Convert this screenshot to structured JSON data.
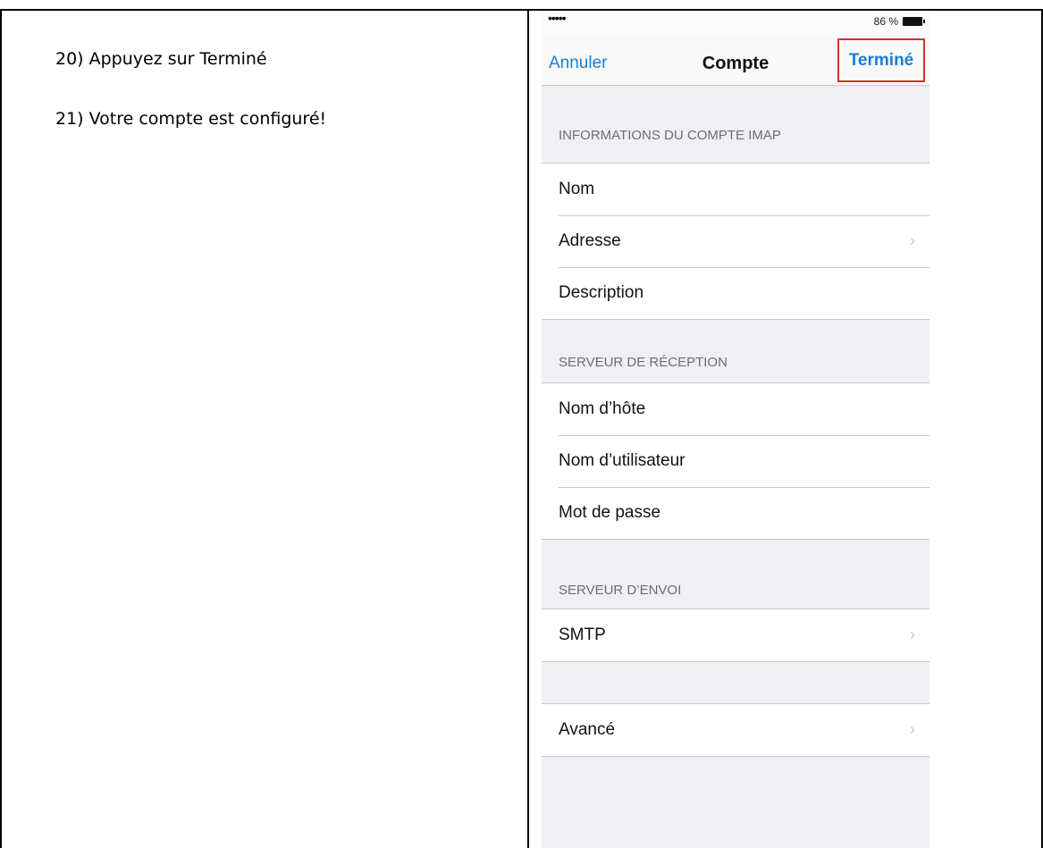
{
  "document": {
    "steps": [
      "20) Appuyez sur Terminé",
      "21) Votre compte est configuré!"
    ]
  },
  "phone": {
    "status_bar": {
      "signal": "•••••",
      "battery_text": "86 %"
    },
    "nav": {
      "cancel": "Annuler",
      "title": "Compte",
      "done": "Terminé"
    },
    "sections": [
      {
        "header": "INFORMATIONS DU COMPTE IMAP",
        "rows": [
          "Nom",
          "Adresse",
          "Description"
        ]
      },
      {
        "header": "SERVEUR DE RÉCEPTION",
        "rows": [
          "Nom d’hôte",
          "Nom d’utilisateur",
          "Mot de passe"
        ]
      },
      {
        "header": "SERVEUR D’ENVOI",
        "rows": [
          "SMTP"
        ]
      },
      {
        "header": "",
        "rows": [
          "Avancé"
        ]
      }
    ],
    "highlight_color": "#d9302a",
    "accent_color": "#1a7ed5"
  }
}
